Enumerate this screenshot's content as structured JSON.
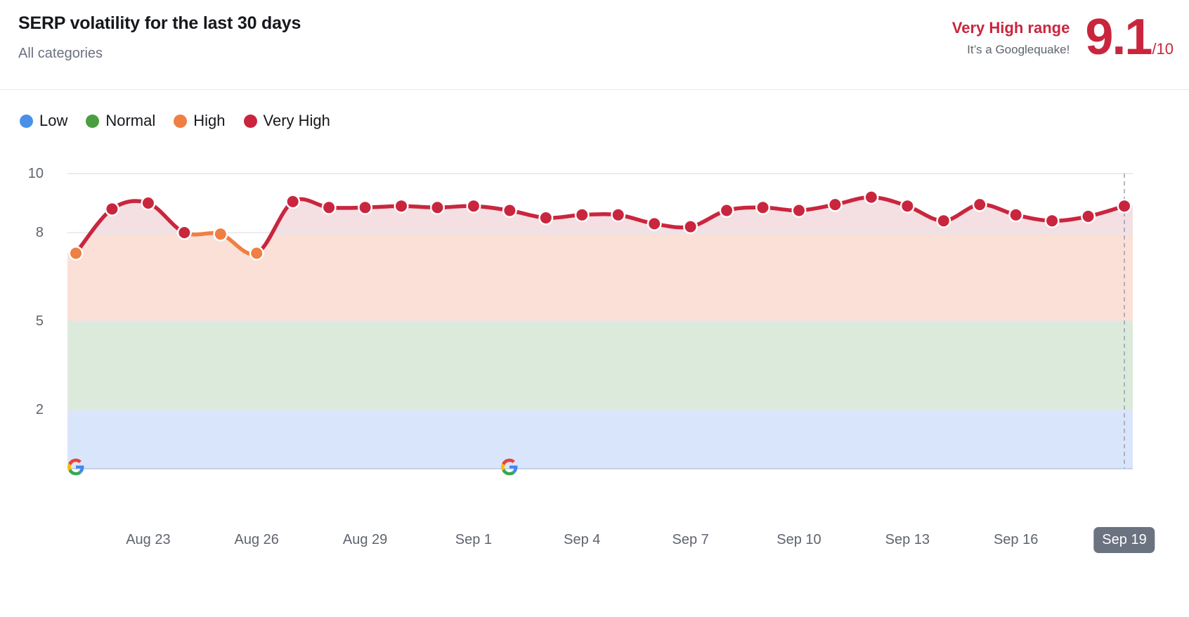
{
  "header": {
    "title": "SERP volatility for the last 30 days",
    "subtitle": "All categories",
    "range_label": "Very High range",
    "range_caption": "It’s a Googlequake!",
    "score_value": "9.1",
    "score_denominator": "/10",
    "accent_color": "#c9263e"
  },
  "legend": {
    "items": [
      {
        "label": "Low",
        "color": "#4a90e8"
      },
      {
        "label": "Normal",
        "color": "#4a9e3f"
      },
      {
        "label": "High",
        "color": "#ef7f43"
      },
      {
        "label": "Very High",
        "color": "#c9263e"
      }
    ]
  },
  "chart_data": {
    "type": "line",
    "title": "SERP volatility for the last 30 days",
    "xlabel": "",
    "ylabel": "",
    "ylim": [
      0,
      10
    ],
    "yticks": [
      10,
      8,
      5,
      2
    ],
    "grid": true,
    "legend_position": "top-left",
    "x": [
      "Aug 21",
      "Aug 22",
      "Aug 23",
      "Aug 24",
      "Aug 25",
      "Aug 26",
      "Aug 27",
      "Aug 28",
      "Aug 29",
      "Aug 30",
      "Aug 31",
      "Sep 1",
      "Sep 2",
      "Sep 3",
      "Sep 4",
      "Sep 5",
      "Sep 6",
      "Sep 7",
      "Sep 8",
      "Sep 9",
      "Sep 10",
      "Sep 11",
      "Sep 12",
      "Sep 13",
      "Sep 14",
      "Sep 15",
      "Sep 16",
      "Sep 17",
      "Sep 18",
      "Sep 19"
    ],
    "xticks": [
      "Aug 23",
      "Aug 26",
      "Aug 29",
      "Sep 1",
      "Sep 4",
      "Sep 7",
      "Sep 10",
      "Sep 13",
      "Sep 16",
      "Sep 19"
    ],
    "current_xtick": "Sep 19",
    "values": [
      7.3,
      8.8,
      9.0,
      8.0,
      7.95,
      7.3,
      9.05,
      8.85,
      8.85,
      8.9,
      8.85,
      8.9,
      8.75,
      8.5,
      8.6,
      8.6,
      8.3,
      8.2,
      8.75,
      8.85,
      8.75,
      8.95,
      9.2,
      8.9,
      8.4,
      8.95,
      8.6,
      8.4,
      8.55,
      8.9
    ],
    "bands": [
      {
        "name": "Low",
        "range": [
          0,
          2
        ],
        "color": "#d9e5fa"
      },
      {
        "name": "Normal",
        "range": [
          2,
          5
        ],
        "color": "#dceadb"
      },
      {
        "name": "High",
        "range": [
          5,
          8
        ],
        "color": "#fbe0d7"
      },
      {
        "name": "Very High",
        "range": [
          8,
          10
        ],
        "color": "#f4dfe2"
      }
    ],
    "series_colors": {
      "high": "#ef7f43",
      "very_high": "#c9263e"
    },
    "threshold": 8,
    "annotations": [
      {
        "name": "google-update-marker",
        "x": "Aug 21",
        "y": 0,
        "icon": "google-icon"
      },
      {
        "name": "google-update-marker",
        "x": "Sep 2",
        "y": 0,
        "icon": "google-icon"
      }
    ]
  }
}
